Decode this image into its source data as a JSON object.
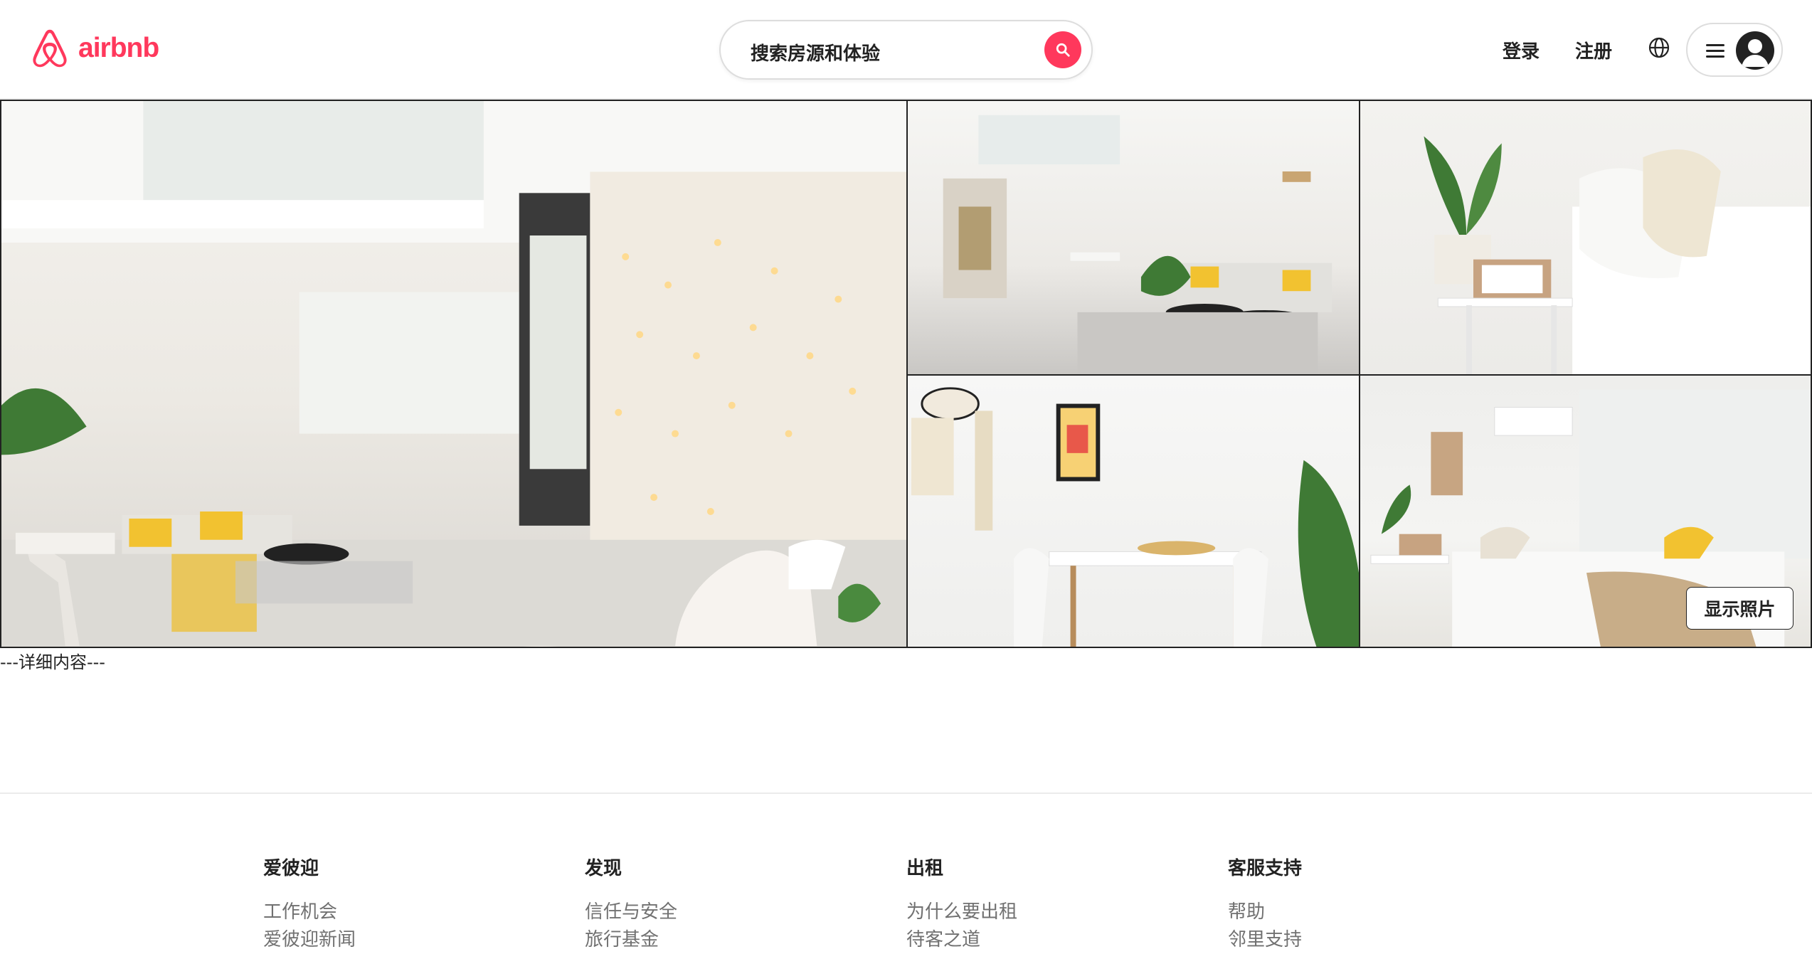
{
  "header": {
    "logo_text": "airbnb",
    "search_placeholder": "搜索房源和体验",
    "login_label": "登录",
    "signup_label": "注册",
    "icons": {
      "logo": "airbnb-logo-icon",
      "search": "search-icon",
      "language": "globe-icon",
      "menu": "hamburger-icon",
      "user": "avatar-icon"
    }
  },
  "colors": {
    "brand": "#ff385c",
    "text": "#222222",
    "muted": "#717171",
    "border": "#dddddd"
  },
  "gallery": {
    "photos": [
      "main living room with string lights",
      "loft living area",
      "bedside calendar",
      "dining corner",
      "bedroom"
    ],
    "show_photos_label": "显示照片"
  },
  "main": {
    "details_placeholder": "---详细内容---"
  },
  "footer": {
    "columns": [
      {
        "title": "爱彼迎",
        "links": [
          "工作机会",
          "爱彼迎新闻"
        ]
      },
      {
        "title": "发现",
        "links": [
          "信任与安全",
          "旅行基金"
        ]
      },
      {
        "title": "出租",
        "links": [
          "为什么要出租",
          "待客之道"
        ]
      },
      {
        "title": "客服支持",
        "links": [
          "帮助",
          "邻里支持"
        ]
      }
    ]
  }
}
